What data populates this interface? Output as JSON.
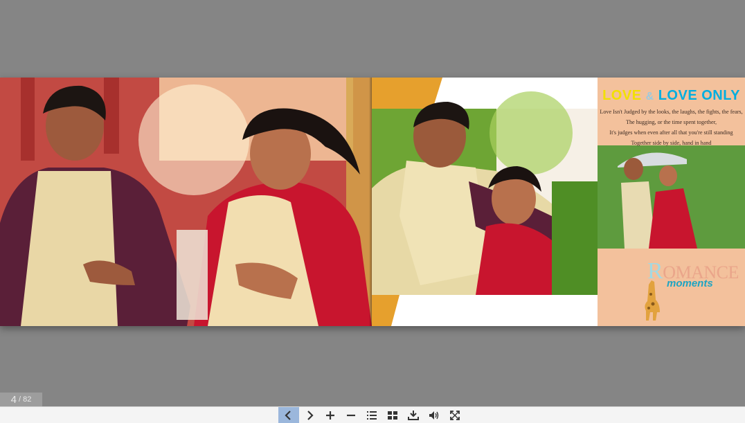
{
  "viewer": {
    "current_page": "4",
    "separator": "/",
    "total_pages": "82"
  },
  "spread": {
    "right_page": {
      "title_word1": "LOVE",
      "title_amp": "&",
      "title_word2": "LOVE ONLY",
      "poem_lines": [
        "Love Isn't Judged by the looks, the laughs, the fights, the fears,",
        "The hugging, or the time spent together,",
        "It's judges when even after all that you're still standing",
        "Together side by side, hand in hand"
      ],
      "romance_cap": "R",
      "romance_rest": "OMANCE",
      "moments": "moments"
    }
  },
  "toolbar": {
    "buttons": [
      {
        "name": "previous-page-button",
        "icon": "chevron-left-icon",
        "active": true
      },
      {
        "name": "next-page-button",
        "icon": "chevron-right-icon"
      },
      {
        "name": "zoom-in-button",
        "icon": "plus-icon"
      },
      {
        "name": "zoom-out-button",
        "icon": "minus-icon"
      },
      {
        "name": "table-of-contents-button",
        "icon": "numbered-list-icon"
      },
      {
        "name": "thumbnails-button",
        "icon": "grid-icon"
      },
      {
        "name": "download-button",
        "icon": "download-icon"
      },
      {
        "name": "sound-button",
        "icon": "speaker-icon"
      },
      {
        "name": "fullscreen-button",
        "icon": "fullscreen-icon"
      }
    ]
  },
  "colors": {
    "background": "#858585",
    "toolbar": "#f4f4f4",
    "active_button": "#9bb7dc",
    "accent_orange": "#e6a02d",
    "panel_peach": "#f3c19c",
    "title_yellow": "#f2e000",
    "title_blue": "#00aee0"
  }
}
